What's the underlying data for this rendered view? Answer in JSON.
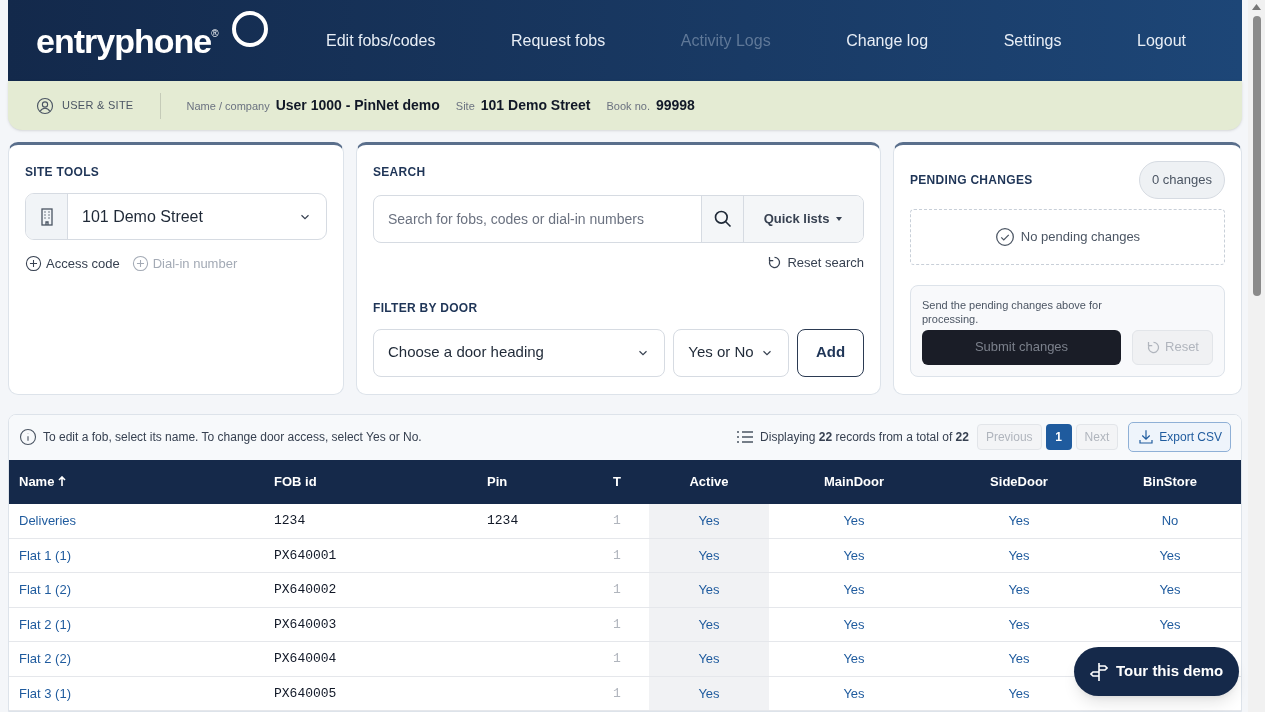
{
  "header": {
    "logo": "entryphone",
    "logo_mark": "®",
    "nav": [
      {
        "label": "Edit fobs/codes",
        "disabled": false
      },
      {
        "label": "Request fobs",
        "disabled": false
      },
      {
        "label": "Activity Logs",
        "disabled": true
      },
      {
        "label": "Change log",
        "disabled": false
      },
      {
        "label": "Settings",
        "disabled": false
      },
      {
        "label": "Logout",
        "disabled": false
      }
    ]
  },
  "info_bar": {
    "section": "USER & SITE",
    "fields": [
      {
        "label": "Name / company",
        "value": "User 1000 - PinNet demo"
      },
      {
        "label": "Site",
        "value": "101 Demo Street"
      },
      {
        "label": "Book no.",
        "value": "99998"
      }
    ]
  },
  "site_tools": {
    "title": "SITE TOOLS",
    "site_select": "101 Demo Street",
    "actions": [
      {
        "label": "Access code",
        "disabled": false
      },
      {
        "label": "Dial-in number",
        "disabled": true
      }
    ]
  },
  "search": {
    "title": "SEARCH",
    "placeholder": "Search for fobs, codes or dial-in numbers",
    "quick_lists": "Quick lists",
    "reset": "Reset search",
    "filter_title": "FILTER BY DOOR",
    "door_select": "Choose a door heading",
    "value_select": "Yes or No",
    "add": "Add"
  },
  "pending": {
    "title": "PENDING CHANGES",
    "count": "0 changes",
    "empty": "No pending changes",
    "note": "Send the pending changes above for processing.",
    "submit": {
      "label": "Submit changes",
      "disabled": true
    },
    "reset": {
      "label": "Reset",
      "disabled": true
    }
  },
  "table": {
    "hint": "To edit a fob, select its name. To change door access, select Yes or No.",
    "summary": "Displaying **22** records from a total of **22**",
    "pagination": {
      "previous": {
        "label": "Previous",
        "disabled": true
      },
      "pages": [
        {
          "label": "1",
          "selected": true
        }
      ],
      "next": {
        "label": "Next",
        "disabled": true
      }
    },
    "export": "Export CSV",
    "columns": [
      {
        "label": "Name",
        "sorted": true,
        "highlighted": false
      },
      {
        "label": "FOB id",
        "sorted": false,
        "highlighted": false
      },
      {
        "label": "Pin",
        "sorted": false,
        "highlighted": false
      },
      {
        "label": "T",
        "sorted": false,
        "highlighted": false
      },
      {
        "label": "Active",
        "sorted": false,
        "highlighted": true
      },
      {
        "label": "MainDoor",
        "sorted": false,
        "highlighted": false
      },
      {
        "label": "SideDoor",
        "sorted": false,
        "highlighted": false
      },
      {
        "label": "BinStore",
        "sorted": false,
        "highlighted": false
      }
    ],
    "rows": [
      {
        "name": "Deliveries",
        "fob_id": "1234",
        "pin": "1234",
        "t": "1",
        "doors": [
          "Yes",
          "Yes",
          "Yes",
          "No"
        ]
      },
      {
        "name": "Flat 1 (1)",
        "fob_id": "PX640001",
        "t": "1",
        "doors": [
          "Yes",
          "Yes",
          "Yes",
          "Yes"
        ]
      },
      {
        "name": "Flat 1 (2)",
        "fob_id": "PX640002",
        "t": "1",
        "doors": [
          "Yes",
          "Yes",
          "Yes",
          "Yes"
        ]
      },
      {
        "name": "Flat 2 (1)",
        "fob_id": "PX640003",
        "t": "1",
        "doors": [
          "Yes",
          "Yes",
          "Yes",
          "Yes"
        ]
      },
      {
        "name": "Flat 2 (2)",
        "fob_id": "PX640004",
        "t": "1",
        "doors": [
          "Yes",
          "Yes",
          "Yes"
        ]
      },
      {
        "name": "Flat 3 (1)",
        "fob_id": "PX640005",
        "t": "1",
        "doors": [
          "Yes",
          "Yes",
          "Yes"
        ]
      }
    ]
  },
  "tour": {
    "label": "Tour this demo"
  }
}
